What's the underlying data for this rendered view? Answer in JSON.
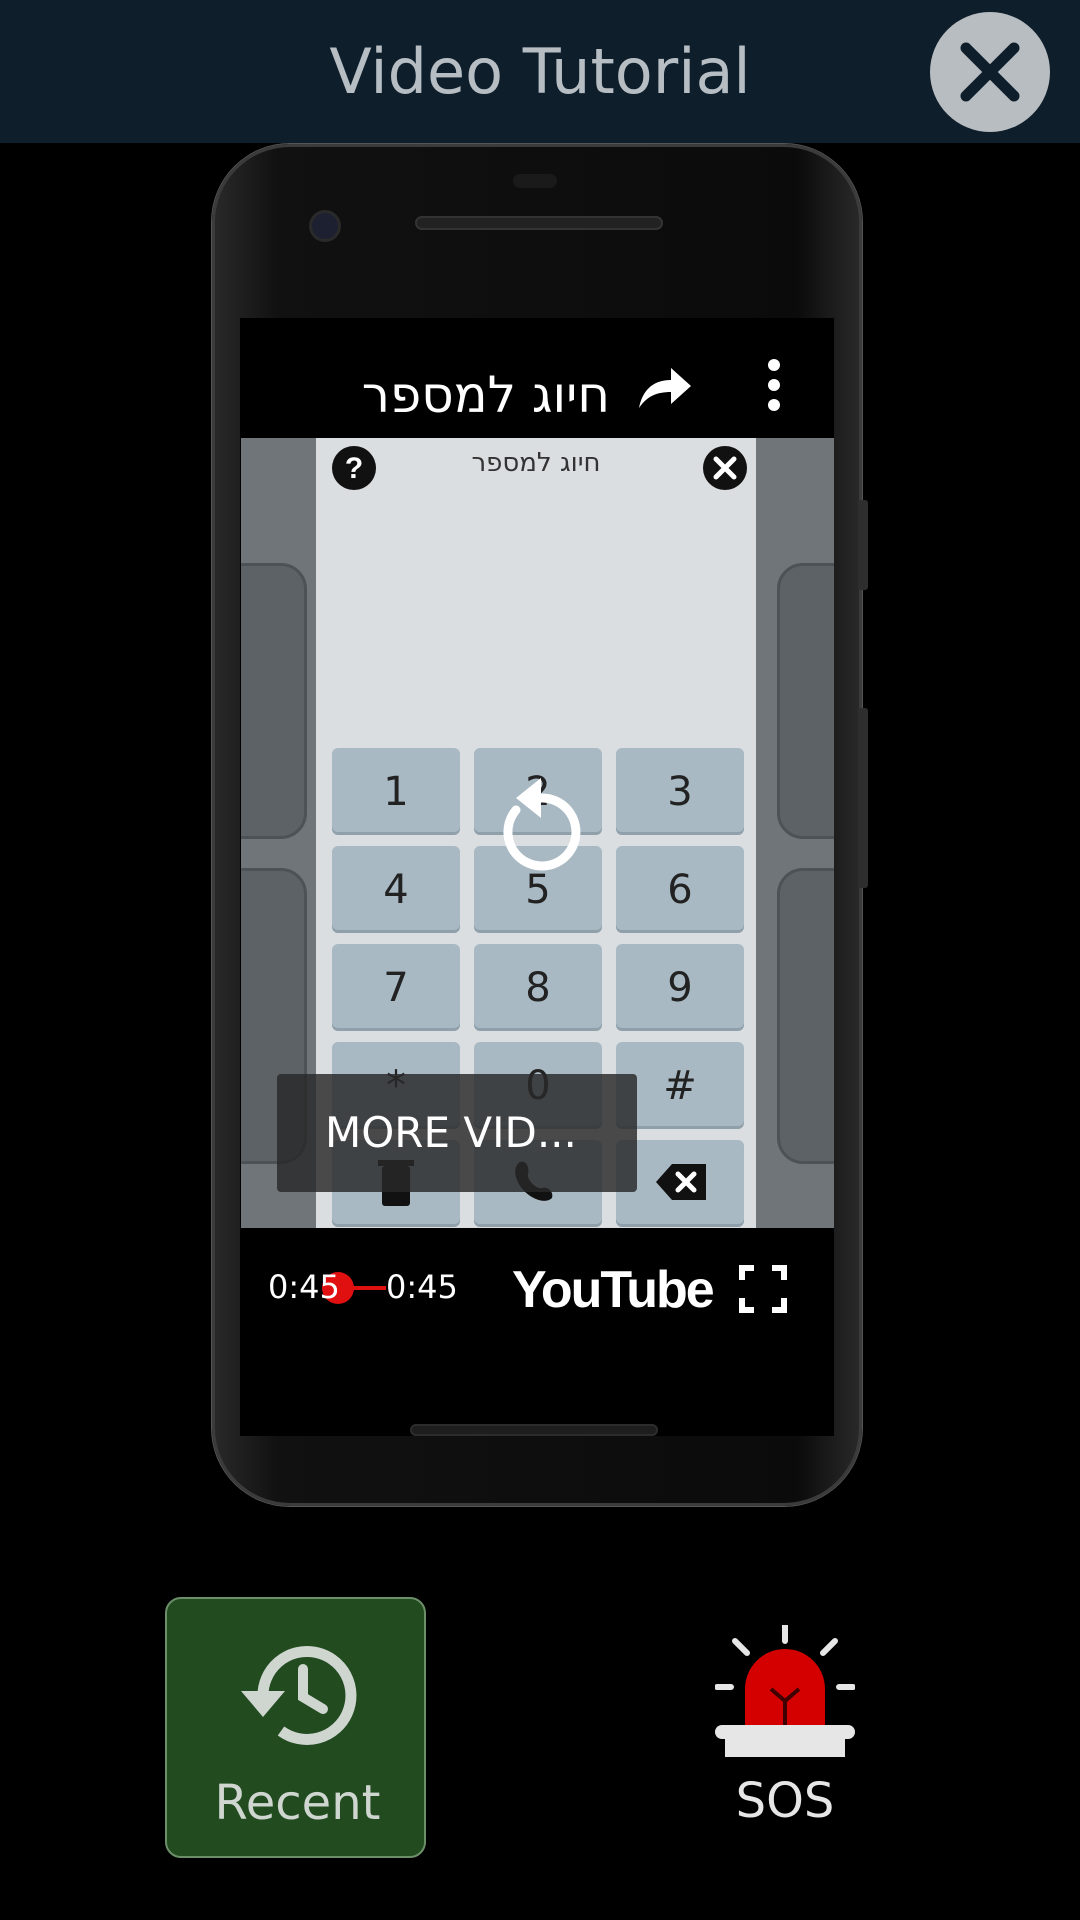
{
  "header": {
    "title": "Video Tutorial",
    "close_icon": "close-icon"
  },
  "video": {
    "title": "חיוג למספר",
    "share_icon": "share-icon",
    "more_icon": "more-vert-icon",
    "dialog": {
      "title": "חיוג למספר",
      "keys": [
        "1",
        "2",
        "3",
        "4",
        "5",
        "6",
        "7",
        "8",
        "9",
        "*",
        "0",
        "#"
      ],
      "action_icons": [
        "trash-icon",
        "phone-icon",
        "backspace-icon"
      ]
    },
    "replay_icon": "replay-icon",
    "more_videos_label": "MORE VID...",
    "time_current": "0:45",
    "time_total": "0:45",
    "progress": 1.0,
    "brand": "YouTube",
    "fullscreen_icon": "fullscreen-icon"
  },
  "bottom": {
    "recent_label": "Recent",
    "sos_label": "SOS"
  },
  "colors": {
    "header_bg": "#0f1e2b",
    "recent_bg": "#224b20",
    "accent_red": "#e01010"
  }
}
